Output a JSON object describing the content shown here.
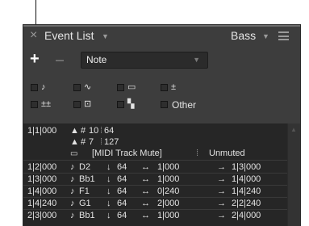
{
  "panel": {
    "title": "Event List",
    "track_name": "Bass"
  },
  "toolbar": {
    "add_label": "+",
    "filter_type": "Note"
  },
  "filters": {
    "other_label": "Other",
    "items": [
      {
        "icon": "note-icon",
        "glyph": "♪"
      },
      {
        "icon": "pitchbend-icon",
        "glyph": "∿"
      },
      {
        "icon": "program-change-icon",
        "glyph": "▭"
      },
      {
        "icon": "controller-icon",
        "glyph": "±"
      },
      {
        "icon": "aftertouch-icon",
        "glyph": "±±"
      },
      {
        "icon": "sysex-icon",
        "glyph": "⊡"
      },
      {
        "icon": "meta-event-icon",
        "glyph": "▚"
      }
    ]
  },
  "events": {
    "first": {
      "position": "1|1|000",
      "sym1": "▲",
      "sym2": "#",
      "val1": "10",
      "val2": "64",
      "sym3": "▲",
      "sym4": "#",
      "val3": "7",
      "val4": "127",
      "meta_label": "[MIDI Track Mute]",
      "meta_value": "Unmuted"
    },
    "rows": [
      {
        "position": "1|2|000",
        "note": "D2",
        "velocity": "64",
        "length": "1|000",
        "end": "1|3|000"
      },
      {
        "position": "1|3|000",
        "note": "Bb1",
        "velocity": "64",
        "length": "1|000",
        "end": "1|4|000"
      },
      {
        "position": "1|4|000",
        "note": "F1",
        "velocity": "64",
        "length": "0|240",
        "end": "1|4|240"
      },
      {
        "position": "1|4|240",
        "note": "G1",
        "velocity": "64",
        "length": "2|000",
        "end": "2|2|240"
      },
      {
        "position": "2|3|000",
        "note": "Bb1",
        "velocity": "64",
        "length": "1|000",
        "end": "2|4|000"
      }
    ]
  }
}
